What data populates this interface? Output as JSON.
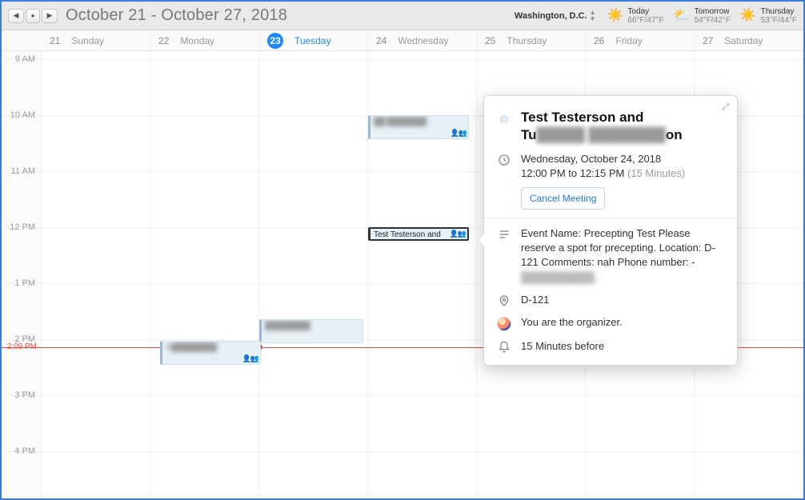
{
  "toolbar": {
    "date_range": "October 21 - October 27, 2018",
    "location": "Washington,  D.C.",
    "weather": [
      {
        "label": "Today",
        "temps": "66°F/47°F",
        "icon": "☀️"
      },
      {
        "label": "Tomorrow",
        "temps": "54°F/42°F",
        "icon": "⛅"
      },
      {
        "label": "Thursday",
        "temps": "53°F/44°F",
        "icon": "☀️"
      }
    ]
  },
  "days": [
    {
      "num": "21",
      "name": "Sunday"
    },
    {
      "num": "22",
      "name": "Monday"
    },
    {
      "num": "23",
      "name": "Tuesday",
      "today": true
    },
    {
      "num": "24",
      "name": "Wednesday"
    },
    {
      "num": "25",
      "name": "Thursday"
    },
    {
      "num": "26",
      "name": "Friday"
    },
    {
      "num": "27",
      "name": "Saturday"
    }
  ],
  "hours": [
    "9 AM",
    "10 AM",
    "11 AM",
    "12 PM",
    "1 PM",
    "2 PM",
    "3 PM",
    "4 PM"
  ],
  "now": {
    "label": "2:09 PM"
  },
  "events": {
    "selected_label": "Test Testerson and",
    "mon_label_masked": "A████████",
    "tue_label_masked": "████████",
    "wed10_label_masked": "██'███████"
  },
  "popover": {
    "title_line1": "Test Testerson and",
    "title_line2_prefix": "Tu",
    "title_line2_masked": "█████ ████████",
    "title_line2_suffix": "on",
    "date": "Wednesday, October 24, 2018",
    "time": "12:00 PM to 12:15 PM",
    "duration": "(15 Minutes)",
    "cancel_label": "Cancel Meeting",
    "description": "Event Name: Precepting Test Please reserve a spot for precepting. Location: D-121 Comments: nah  Phone number: -",
    "description_masked": "██████████…",
    "location": "D-121",
    "organizer": "You are the organizer.",
    "reminder": "15 Minutes before"
  }
}
